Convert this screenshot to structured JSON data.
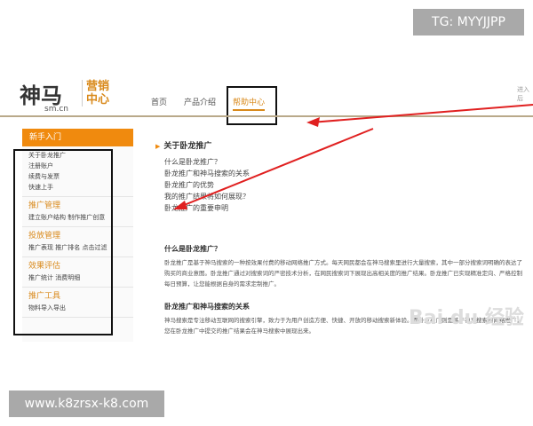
{
  "overlay": {
    "tg": "TG: MYYJJPP",
    "website": "www.k8zrsx-k8.com"
  },
  "header": {
    "logo_main": "神马",
    "logo_sub": "营销中心",
    "logo_domain": "sm.cn",
    "nav": [
      "首页",
      "产品介绍",
      "帮助中心"
    ],
    "top_right": "进入后"
  },
  "sidebar": {
    "header": "新手入门",
    "intro_items": [
      "关于卧龙推广",
      "注册账户",
      "续费与发票",
      "快速上手"
    ],
    "sections": [
      {
        "title": "推广管理",
        "items": "建立账户结构  制作推广创意"
      },
      {
        "title": "投放管理",
        "items": "推广表现  推广排名  点击过滤"
      },
      {
        "title": "效果评估",
        "items": "推广统计  消费明细"
      },
      {
        "title": "推广工具",
        "items": "物料导入导出"
      }
    ]
  },
  "main": {
    "title": "关于卧龙推广",
    "links": [
      "什么是卧龙推广？",
      "卧龙推广和神马搜索的关系",
      "卧龙推广的优势",
      "我的推广结果将如何展现？",
      "卧龙推广的重要申明"
    ],
    "q1": "什么是卧龙推广？",
    "a1": "卧龙推广是基于神马搜索的一种按效果付费的移动网络推广方式。每天网民都会在神马搜索里进行大量搜索，其中一部分搜索词明确的表达了购买的商业意图。卧龙推广通过对搜索词的严密技术分析，在网民搜索词下展现出高相关度的推广结果。卧龙推广已实现精准定向、严格控制每日预算，让您能根据自身的需求定制推广。",
    "q2": "卧龙推广和神马搜索的关系",
    "a2": "神马搜索是专注移动互联网的搜索引擎，致力于为用户创造方便、快捷、开放的移动搜索新体验。而卧龙推广则是基于神马搜索的网络推广，您在卧龙推广中提交的推广结果会在神马搜索中展现出来。",
    "watermark": "Bai du 经验"
  },
  "colors": {
    "accent": "#f08a0e",
    "annotation_arrow": "#e02020"
  }
}
